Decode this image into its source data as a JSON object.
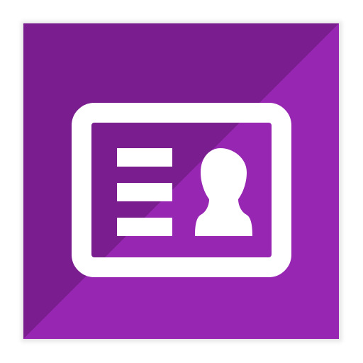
{
  "icon": {
    "name": "contact-card-icon",
    "colors": {
      "dark": "#7a1e8f",
      "light": "#9726b2",
      "foreground": "#ffffff"
    },
    "lines": [
      "line-1",
      "line-2",
      "line-3"
    ]
  }
}
